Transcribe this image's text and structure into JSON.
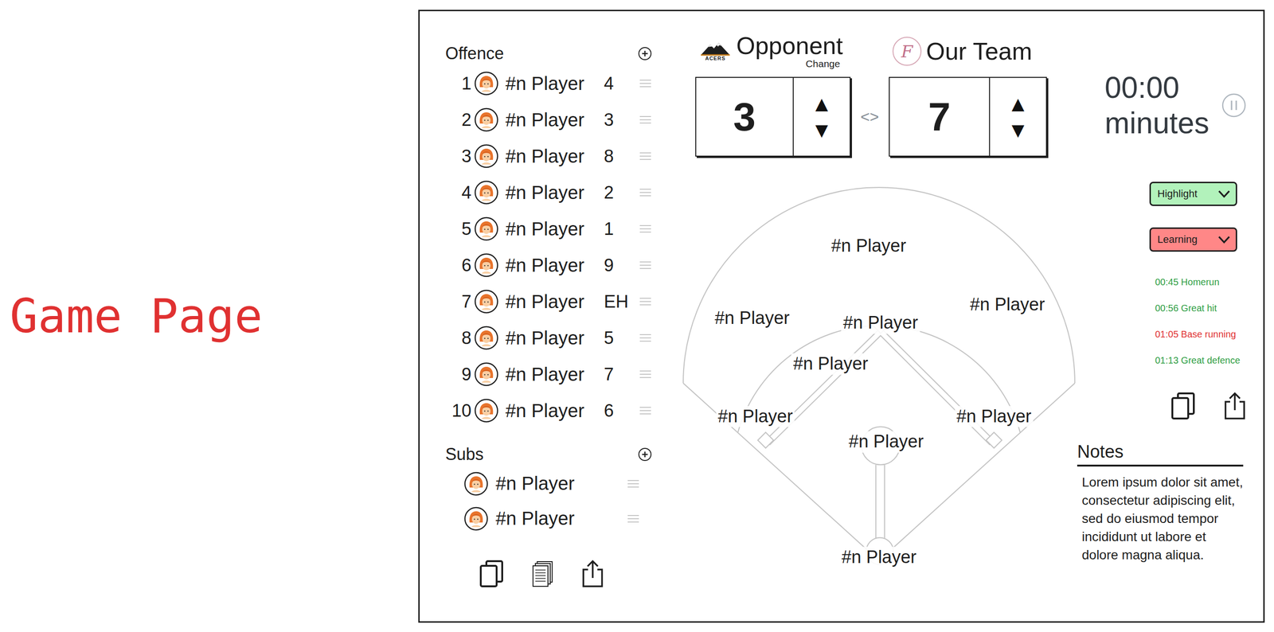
{
  "page_title": "Game Page",
  "offence": {
    "title": "Offence",
    "players": [
      {
        "order": "1",
        "name": "#n Player",
        "position": "4"
      },
      {
        "order": "2",
        "name": "#n Player",
        "position": "3"
      },
      {
        "order": "3",
        "name": "#n Player",
        "position": "8"
      },
      {
        "order": "4",
        "name": "#n Player",
        "position": "2"
      },
      {
        "order": "5",
        "name": "#n Player",
        "position": "1"
      },
      {
        "order": "6",
        "name": "#n Player",
        "position": "9"
      },
      {
        "order": "7",
        "name": "#n Player",
        "position": "EH"
      },
      {
        "order": "8",
        "name": "#n Player",
        "position": "5"
      },
      {
        "order": "9",
        "name": "#n Player",
        "position": "7"
      },
      {
        "order": "10",
        "name": "#n Player",
        "position": "6"
      }
    ]
  },
  "subs": {
    "title": "Subs",
    "players": [
      {
        "name": "#n Player"
      },
      {
        "name": "#n Player"
      }
    ]
  },
  "scoreboard": {
    "opponent": {
      "name": "Opponent",
      "logo_text": "ACERS",
      "change": "Change",
      "score": "3",
      "up": "▲",
      "down": "▼"
    },
    "swap": "<>",
    "our_team": {
      "name": "Our Team",
      "logo_text": "F",
      "score": "7",
      "up": "▲",
      "down": "▼"
    }
  },
  "timer": {
    "time": "00:00",
    "unit": "minutes"
  },
  "field": {
    "players": [
      "#n Player",
      "#n Player",
      "#n Player",
      "#n Player",
      "#n Player",
      "#n Player",
      "#n Player",
      "#n Player",
      "#n Player"
    ]
  },
  "tags": [
    {
      "label": "Highlight",
      "color": "#b2f2bb"
    },
    {
      "label": "Learning",
      "color": "#ff8787"
    }
  ],
  "events": [
    {
      "text": "00:45 Homerun",
      "color": "#2f9e44"
    },
    {
      "text": "00:56 Great hit",
      "color": "#2f9e44"
    },
    {
      "text": "01:05 Base running",
      "color": "#e03131"
    },
    {
      "text": "01:13 Great defence",
      "color": "#2f9e44"
    }
  ],
  "notes": {
    "title": "Notes",
    "text": "Lorem ipsum dolor sit amet, consectetur adipiscing elit, sed do eiusmod tempor incididunt ut labore et dolore magna aliqua."
  }
}
